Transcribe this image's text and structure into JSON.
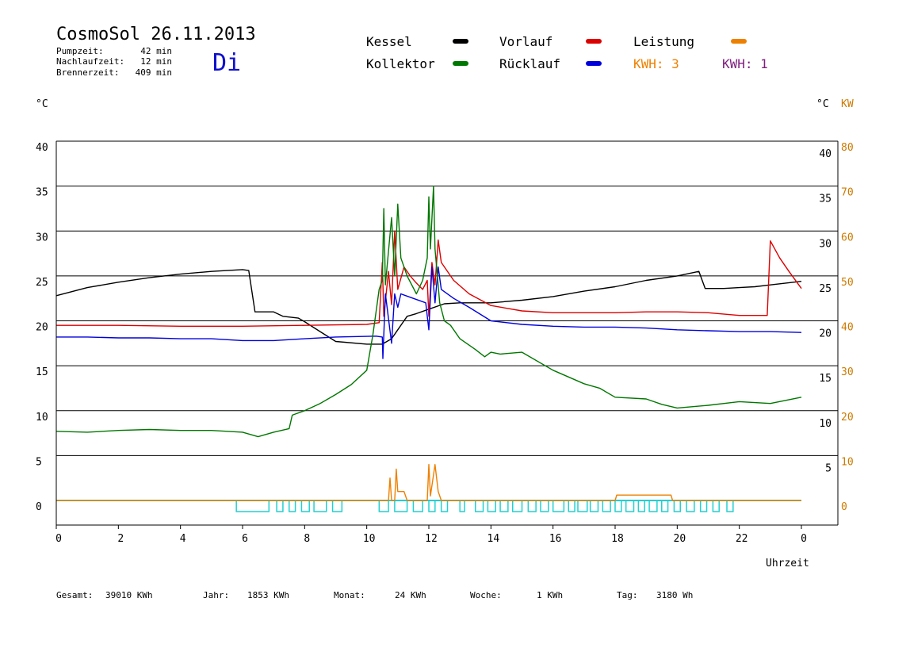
{
  "header": {
    "title": "CosmoSol 26.11.2013",
    "day": "Di",
    "times": [
      {
        "label": "Pumpzeit:",
        "value": "42 min"
      },
      {
        "label": "Nachlaufzeit:",
        "value": "12 min"
      },
      {
        "label": "Brennerzeit:",
        "value": "409 min"
      }
    ]
  },
  "legend": [
    {
      "label": "Kessel",
      "color": "#000000"
    },
    {
      "label": "Vorlauf",
      "color": "#dd0000"
    },
    {
      "label": "Leistung",
      "color": "#ee8000",
      "label_color": "#000000"
    },
    {
      "label": "Kollektor",
      "color": "#007700"
    },
    {
      "label": "Rücklauf",
      "color": "#0000dd"
    }
  ],
  "kwh": [
    {
      "text": "KWH: 3",
      "color": "#ee8000"
    },
    {
      "text": "KWH: 1",
      "color": "#802080"
    }
  ],
  "axes": {
    "left_unit": "°C",
    "right_unit": "°C",
    "kw_unit": "KW",
    "xlabel": "Uhrzeit"
  },
  "footer": [
    {
      "label": "Gesamt:",
      "value": "39010 KWh"
    },
    {
      "label": "Jahr:",
      "value": "1853 KWh"
    },
    {
      "label": "Monat:",
      "value": "24 KWh"
    },
    {
      "label": "Woche:",
      "value": "1 KWh"
    },
    {
      "label": "Tag:",
      "value": "3180 Wh"
    }
  ],
  "chart_data": {
    "type": "line",
    "xlabel": "Uhrzeit",
    "ylabel": "°C",
    "y2label": "KW",
    "xlim": [
      0,
      24
    ],
    "ylim": [
      0,
      40
    ],
    "y2lim": [
      0,
      80
    ],
    "x_ticks": [
      "0",
      "2",
      "4",
      "6",
      "8",
      "10",
      "12",
      "14",
      "16",
      "18",
      "20",
      "22",
      "0"
    ],
    "y_ticks": [
      0,
      5,
      10,
      15,
      20,
      25,
      30,
      35,
      40
    ],
    "y2_ticks": [
      0,
      10,
      20,
      30,
      40,
      50,
      60,
      70,
      80
    ],
    "grid": true,
    "legend": "top",
    "series": [
      {
        "name": "Kessel",
        "color": "#000000",
        "points": [
          [
            0,
            22.8
          ],
          [
            1,
            23.7
          ],
          [
            2,
            24.3
          ],
          [
            3,
            24.8
          ],
          [
            4,
            25.2
          ],
          [
            5,
            25.5
          ],
          [
            6,
            25.7
          ],
          [
            6.2,
            25.6
          ],
          [
            6.4,
            21.0
          ],
          [
            7,
            21.0
          ],
          [
            7.3,
            20.5
          ],
          [
            7.8,
            20.3
          ],
          [
            8,
            19.9
          ],
          [
            8.5,
            18.8
          ],
          [
            9,
            17.7
          ],
          [
            10,
            17.4
          ],
          [
            10.5,
            17.4
          ],
          [
            10.8,
            18.0
          ],
          [
            11,
            19.0
          ],
          [
            11.3,
            20.5
          ],
          [
            11.6,
            20.8
          ],
          [
            12,
            21.3
          ],
          [
            12.5,
            21.9
          ],
          [
            13,
            22.0
          ],
          [
            14,
            22.0
          ],
          [
            15,
            22.3
          ],
          [
            16,
            22.7
          ],
          [
            17,
            23.3
          ],
          [
            18,
            23.8
          ],
          [
            19,
            24.5
          ],
          [
            20,
            25.0
          ],
          [
            20.7,
            25.5
          ],
          [
            20.9,
            23.6
          ],
          [
            21.5,
            23.6
          ],
          [
            22,
            23.7
          ],
          [
            22.5,
            23.8
          ],
          [
            23,
            24.0
          ],
          [
            23.5,
            24.2
          ],
          [
            24,
            24.4
          ]
        ]
      },
      {
        "name": "Vorlauf",
        "color": "#dd0000",
        "points": [
          [
            0,
            19.5
          ],
          [
            2,
            19.5
          ],
          [
            4,
            19.4
          ],
          [
            6,
            19.4
          ],
          [
            8,
            19.5
          ],
          [
            10,
            19.6
          ],
          [
            10.4,
            19.8
          ],
          [
            10.5,
            26.5
          ],
          [
            10.55,
            20.5
          ],
          [
            10.7,
            25.5
          ],
          [
            10.8,
            21.8
          ],
          [
            10.9,
            30.0
          ],
          [
            11.0,
            23.5
          ],
          [
            11.2,
            26.0
          ],
          [
            11.4,
            25.0
          ],
          [
            11.6,
            24.2
          ],
          [
            11.8,
            23.5
          ],
          [
            11.95,
            24.5
          ],
          [
            12.0,
            20.5
          ],
          [
            12.1,
            26.5
          ],
          [
            12.2,
            24.0
          ],
          [
            12.3,
            29.0
          ],
          [
            12.4,
            26.5
          ],
          [
            12.8,
            24.5
          ],
          [
            13.3,
            23.0
          ],
          [
            14,
            21.7
          ],
          [
            15,
            21.1
          ],
          [
            16,
            20.9
          ],
          [
            17,
            20.9
          ],
          [
            18,
            20.9
          ],
          [
            19,
            21.0
          ],
          [
            20,
            21.0
          ],
          [
            21,
            20.9
          ],
          [
            22,
            20.6
          ],
          [
            22.9,
            20.6
          ],
          [
            23.0,
            28.9
          ],
          [
            23.3,
            27.0
          ],
          [
            23.6,
            25.5
          ],
          [
            24,
            23.6
          ]
        ]
      },
      {
        "name": "Rücklauf",
        "color": "#0000dd",
        "points": [
          [
            0,
            18.2
          ],
          [
            1,
            18.2
          ],
          [
            2,
            18.1
          ],
          [
            3,
            18.1
          ],
          [
            4,
            18.0
          ],
          [
            5,
            18.0
          ],
          [
            6,
            17.8
          ],
          [
            7,
            17.8
          ],
          [
            8,
            18.0
          ],
          [
            9,
            18.2
          ],
          [
            10.3,
            18.3
          ],
          [
            10.5,
            18.2
          ],
          [
            10.52,
            15.8
          ],
          [
            10.6,
            23.0
          ],
          [
            10.8,
            17.5
          ],
          [
            10.9,
            23.0
          ],
          [
            11.0,
            21.5
          ],
          [
            11.1,
            23.0
          ],
          [
            11.5,
            22.5
          ],
          [
            11.9,
            22.0
          ],
          [
            12.0,
            19.0
          ],
          [
            12.1,
            26.0
          ],
          [
            12.2,
            22.0
          ],
          [
            12.3,
            26.0
          ],
          [
            12.4,
            23.5
          ],
          [
            12.8,
            22.5
          ],
          [
            13.3,
            21.5
          ],
          [
            14,
            20.0
          ],
          [
            15,
            19.6
          ],
          [
            16,
            19.4
          ],
          [
            17,
            19.3
          ],
          [
            18,
            19.3
          ],
          [
            19,
            19.2
          ],
          [
            20,
            19.0
          ],
          [
            21,
            18.9
          ],
          [
            22,
            18.8
          ],
          [
            23,
            18.8
          ],
          [
            24,
            18.7
          ]
        ]
      },
      {
        "name": "Kollektor",
        "color": "#007700",
        "points": [
          [
            0,
            7.7
          ],
          [
            1,
            7.6
          ],
          [
            2,
            7.8
          ],
          [
            3,
            7.9
          ],
          [
            4,
            7.8
          ],
          [
            5,
            7.8
          ],
          [
            6,
            7.6
          ],
          [
            6.5,
            7.1
          ],
          [
            7,
            7.6
          ],
          [
            7.5,
            8.0
          ],
          [
            7.6,
            9.5
          ],
          [
            8,
            10.0
          ],
          [
            8.5,
            10.8
          ],
          [
            9,
            11.8
          ],
          [
            9.5,
            12.9
          ],
          [
            10,
            14.5
          ],
          [
            10.2,
            18.5
          ],
          [
            10.4,
            23.5
          ],
          [
            10.5,
            24.5
          ],
          [
            10.55,
            32.5
          ],
          [
            10.6,
            24.0
          ],
          [
            10.8,
            31.5
          ],
          [
            10.9,
            25.0
          ],
          [
            11.0,
            33.0
          ],
          [
            11.1,
            27.0
          ],
          [
            11.3,
            25.0
          ],
          [
            11.6,
            23.0
          ],
          [
            11.8,
            24.5
          ],
          [
            11.95,
            27.0
          ],
          [
            12.0,
            33.8
          ],
          [
            12.05,
            28.0
          ],
          [
            12.15,
            35.0
          ],
          [
            12.2,
            28.0
          ],
          [
            12.35,
            22.0
          ],
          [
            12.5,
            20.0
          ],
          [
            12.7,
            19.5
          ],
          [
            13,
            18.0
          ],
          [
            13.5,
            16.8
          ],
          [
            13.8,
            16.0
          ],
          [
            14,
            16.5
          ],
          [
            14.3,
            16.3
          ],
          [
            15,
            16.5
          ],
          [
            16,
            14.5
          ],
          [
            17,
            13.0
          ],
          [
            17.5,
            12.5
          ],
          [
            18,
            11.5
          ],
          [
            19,
            11.3
          ],
          [
            19.5,
            10.7
          ],
          [
            20,
            10.3
          ],
          [
            21,
            10.6
          ],
          [
            22,
            11.0
          ],
          [
            23,
            10.8
          ],
          [
            24,
            11.5
          ]
        ]
      },
      {
        "name": "Leistung",
        "color": "#ee8000",
        "axis": "right",
        "points": [
          [
            0,
            0
          ],
          [
            10.7,
            0
          ],
          [
            10.75,
            5
          ],
          [
            10.8,
            0
          ],
          [
            10.9,
            0
          ],
          [
            10.95,
            7
          ],
          [
            11.0,
            2
          ],
          [
            11.2,
            2
          ],
          [
            11.3,
            0
          ],
          [
            11.95,
            0
          ],
          [
            12.0,
            8
          ],
          [
            12.05,
            1
          ],
          [
            12.2,
            8
          ],
          [
            12.3,
            2
          ],
          [
            12.4,
            0
          ],
          [
            18,
            0
          ],
          [
            18.05,
            1.2
          ],
          [
            19.8,
            1.2
          ],
          [
            19.85,
            0
          ],
          [
            24,
            0
          ]
        ]
      }
    ]
  }
}
